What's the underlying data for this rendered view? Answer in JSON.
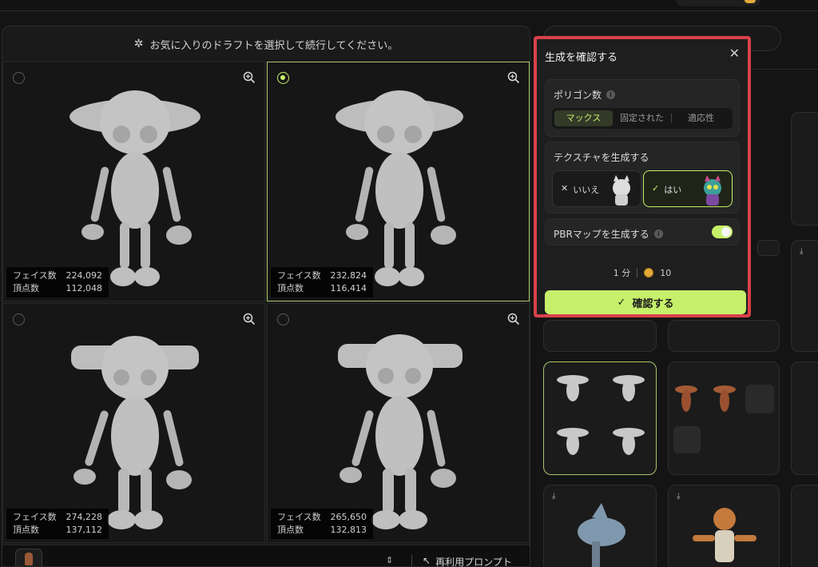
{
  "header": {
    "instruction": "お気に入りのドラフトを選択して続行してください。"
  },
  "drafts": [
    {
      "faces_label": "フェイス数",
      "faces": "224,092",
      "verts_label": "頂点数",
      "verts": "112,048",
      "selected": false
    },
    {
      "faces_label": "フェイス数",
      "faces": "232,824",
      "verts_label": "頂点数",
      "verts": "116,414",
      "selected": true
    },
    {
      "faces_label": "フェイス数",
      "faces": "274,228",
      "verts_label": "頂点数",
      "verts": "137,112",
      "selected": false
    },
    {
      "faces_label": "フェイス数",
      "faces": "265,650",
      "verts_label": "頂点数",
      "verts": "132,813",
      "selected": false
    }
  ],
  "bottom": {
    "reuse_prompt": "再利用プロンプト"
  },
  "dialog": {
    "title": "生成を確認する",
    "polygon_label": "ポリゴン数",
    "polygon_options": [
      "マックス",
      "固定された",
      "適応性"
    ],
    "polygon_active": "マックス",
    "texture_label": "テクスチャを生成する",
    "texture_no": "いいえ",
    "texture_yes": "はい",
    "pbr_label": "PBRマップを生成する",
    "pbr_enabled": true,
    "time": "1 分",
    "credits": "10",
    "confirm_label": "確認する"
  },
  "colors": {
    "accent": "#c6f06a",
    "highlight_border": "#d9414b"
  }
}
